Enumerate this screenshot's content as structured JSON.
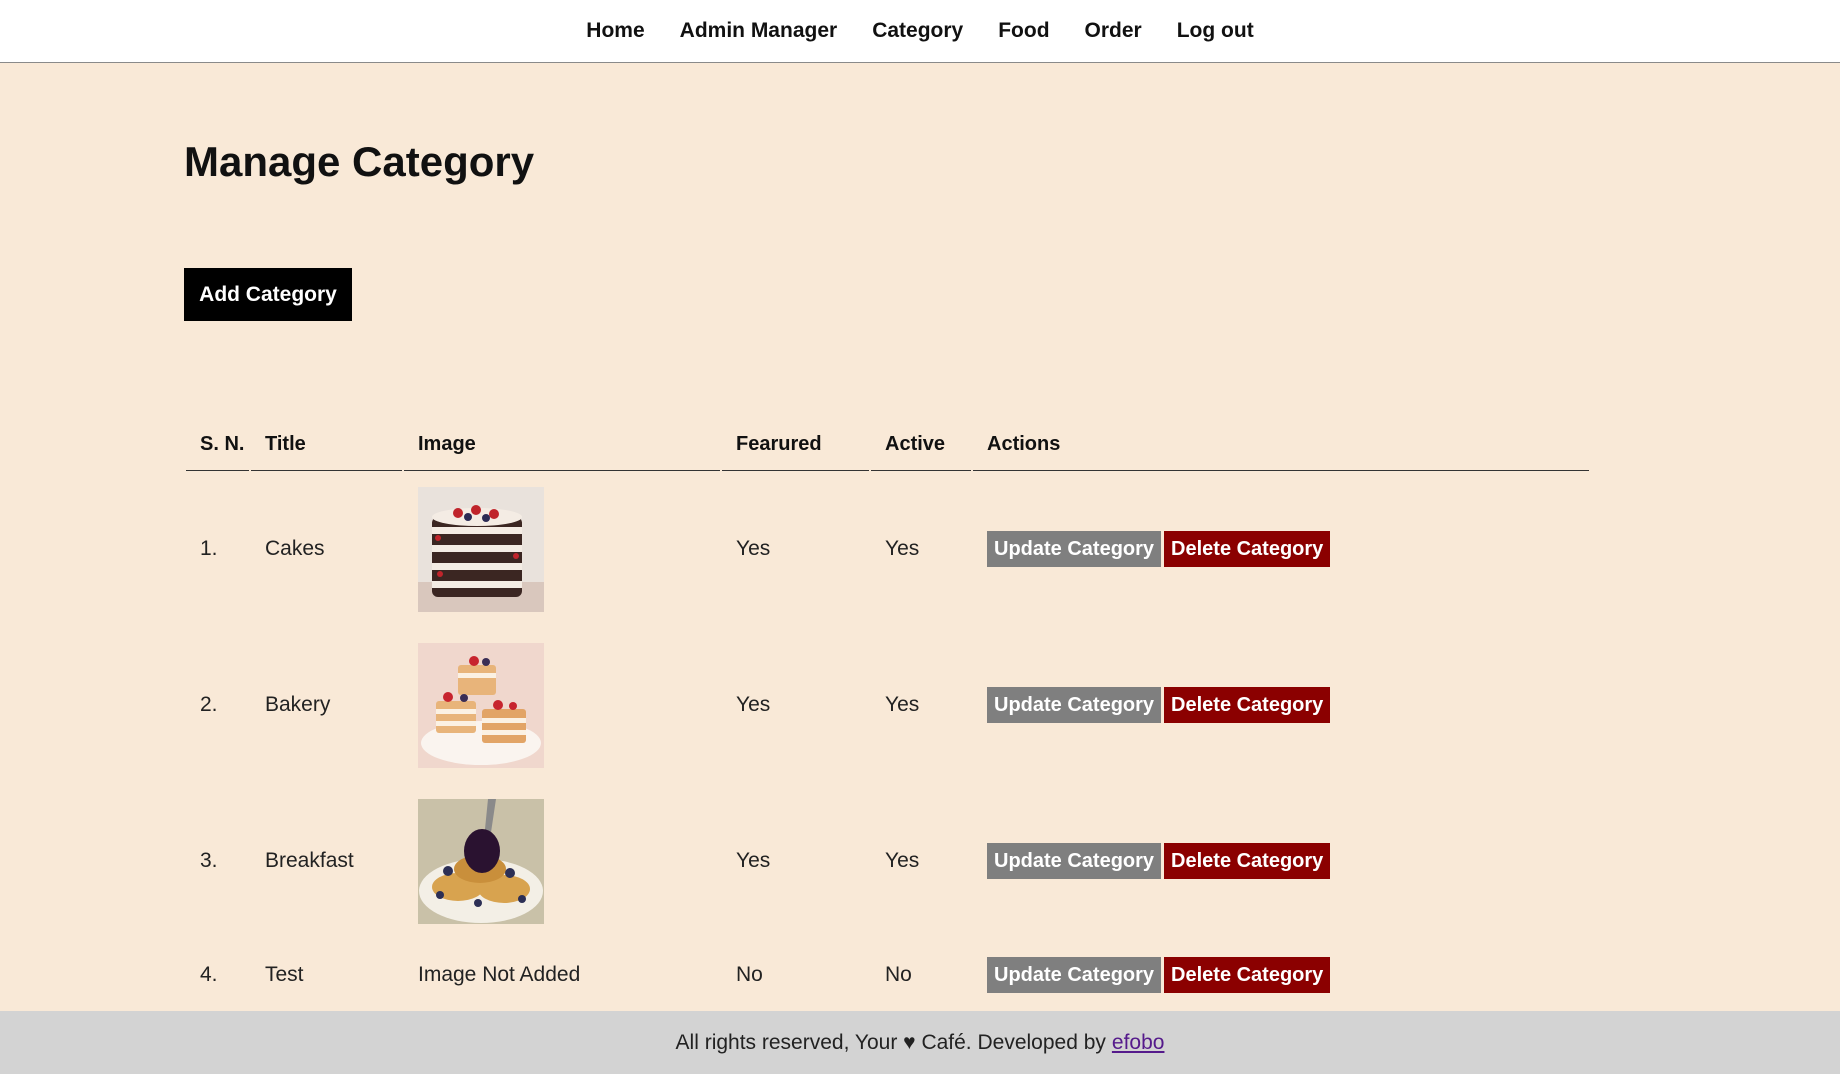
{
  "nav": {
    "items": [
      {
        "label": "Home"
      },
      {
        "label": "Admin Manager"
      },
      {
        "label": "Category"
      },
      {
        "label": "Food"
      },
      {
        "label": "Order"
      },
      {
        "label": "Log out"
      }
    ]
  },
  "page": {
    "title": "Manage Category",
    "add_button": "Add Category"
  },
  "table": {
    "headers": [
      "S. N.",
      "Title",
      "Image",
      "Fearured",
      "Active",
      "Actions"
    ],
    "rows": [
      {
        "sn": "1.",
        "title": "Cakes",
        "image": "cake-image",
        "featured": "Yes",
        "active": "Yes"
      },
      {
        "sn": "2.",
        "title": "Bakery",
        "image": "pastry-image",
        "featured": "Yes",
        "active": "Yes"
      },
      {
        "sn": "3.",
        "title": "Breakfast",
        "image": "pancakes-image",
        "featured": "Yes",
        "active": "Yes"
      },
      {
        "sn": "4.",
        "title": "Test",
        "image_text": "Image Not Added",
        "featured": "No",
        "active": "No"
      }
    ],
    "update_label": "Update Category",
    "delete_label": "Delete Category"
  },
  "footer": {
    "text": "All rights reserved, Your ♥ Café. Developed by",
    "link_text": "efobo"
  },
  "colors": {
    "page_bg": "#f9e9d7",
    "update_button": "#7f7f7f",
    "delete_button": "#8b0000",
    "no_image_text": "#e0283a",
    "footer_bg": "#d3d3d3"
  }
}
